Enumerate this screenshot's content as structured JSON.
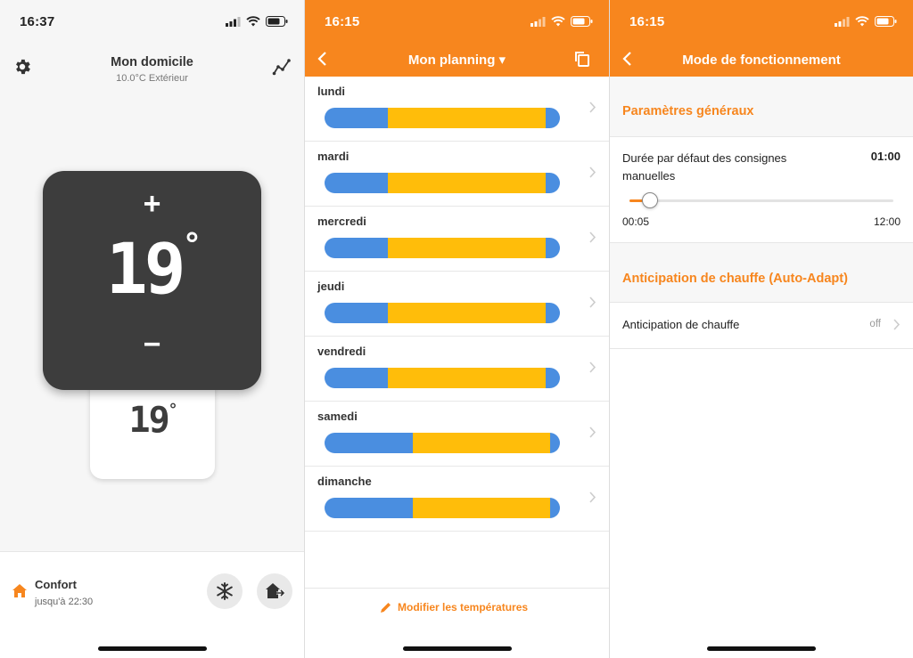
{
  "colors": {
    "accent": "#f7861e",
    "night": "#4a8ee0",
    "comfort": "#ffbd0a",
    "dark_screen": "#3d3d3d"
  },
  "screen1": {
    "status_time": "16:37",
    "title": "Mon domicile",
    "subtitle": "10.0°C Extérieur",
    "setpoint": "19",
    "setpoint_unit": "°",
    "plus": "+",
    "minus": "−",
    "current_temp": "19",
    "current_unit": "°",
    "mode": {
      "name": "Confort",
      "until": "jusqu'à 22:30"
    },
    "icons": [
      "gear-icon",
      "graph-icon",
      "home-icon",
      "snowflake-icon",
      "house-away-icon"
    ]
  },
  "screen2": {
    "status_time": "16:15",
    "title": "Mon planning ▾",
    "days": [
      {
        "label": "lundi",
        "comfort_start": 0.27,
        "comfort_end": 0.94
      },
      {
        "label": "mardi",
        "comfort_start": 0.27,
        "comfort_end": 0.94
      },
      {
        "label": "mercredi",
        "comfort_start": 0.27,
        "comfort_end": 0.94
      },
      {
        "label": "jeudi",
        "comfort_start": 0.27,
        "comfort_end": 0.94
      },
      {
        "label": "vendredi",
        "comfort_start": 0.27,
        "comfort_end": 0.94
      },
      {
        "label": "samedi",
        "comfort_start": 0.375,
        "comfort_end": 0.96
      },
      {
        "label": "dimanche",
        "comfort_start": 0.375,
        "comfort_end": 0.96
      }
    ],
    "edit_label": "Modifier les températures"
  },
  "screen3": {
    "status_time": "16:15",
    "title": "Mode de fonctionnement",
    "section_general": "Paramètres généraux",
    "duree_label": "Durée par défaut des consignes manuelles",
    "duree_value": "01:00",
    "slider_min": "00:05",
    "slider_max": "12:00",
    "slider_fraction": 0.077,
    "section_antic": "Anticipation de chauffe (Auto-Adapt)",
    "antic_label": "Anticipation de chauffe",
    "antic_value": "off"
  }
}
